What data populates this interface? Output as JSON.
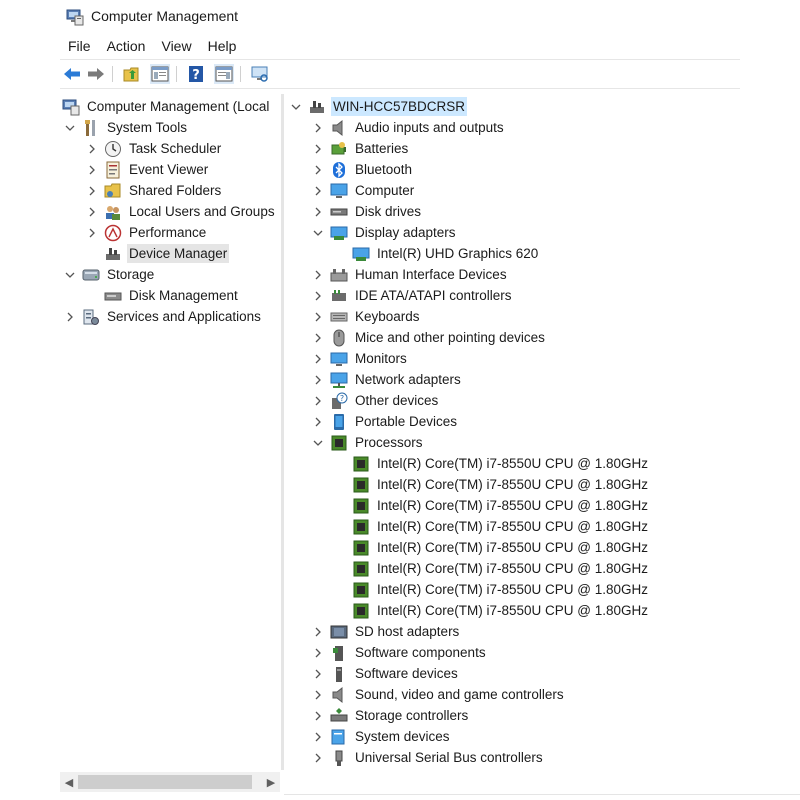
{
  "window": {
    "title": "Computer Management",
    "icon": "computer-management-icon"
  },
  "menu": {
    "file": "File",
    "action": "Action",
    "view": "View",
    "help": "Help"
  },
  "toolbar": {
    "buttons": [
      "back-arrow-icon",
      "forward-arrow-icon",
      "up-folder-icon",
      "show-hide-tree-icon",
      "help-icon",
      "properties-icon",
      "monitor-icon"
    ],
    "colors": {
      "back": "#2b7bd6",
      "forward": "#7a7a7a"
    }
  },
  "left_tree": {
    "root": "Computer Management (Local",
    "system_tools": "System Tools",
    "task_scheduler": "Task Scheduler",
    "event_viewer": "Event Viewer",
    "shared_folders": "Shared Folders",
    "local_users": "Local Users and Groups",
    "performance": "Performance",
    "device_manager": "Device Manager",
    "storage": "Storage",
    "disk_management": "Disk Management",
    "services": "Services and Applications"
  },
  "device_tree": {
    "computer_name": "WIN-HCC57BDCRSR",
    "categories": {
      "audio": "Audio inputs and outputs",
      "batteries": "Batteries",
      "bluetooth": "Bluetooth",
      "computer": "Computer",
      "disk_drives": "Disk drives",
      "display_adapters": "Display adapters",
      "display_child": "Intel(R) UHD Graphics 620",
      "hid": "Human Interface Devices",
      "ide": "IDE ATA/ATAPI controllers",
      "keyboards": "Keyboards",
      "mice": "Mice and other pointing devices",
      "monitors": "Monitors",
      "network": "Network adapters",
      "other": "Other devices",
      "portable": "Portable Devices",
      "processors": "Processors",
      "cpu": "Intel(R) Core(TM) i7-8550U CPU @ 1.80GHz",
      "sd_host": "SD host adapters",
      "software_components": "Software components",
      "software_devices": "Software devices",
      "sound": "Sound, video and game controllers",
      "storage_controllers": "Storage controllers",
      "system_devices": "System devices",
      "usb": "Universal Serial Bus controllers"
    }
  },
  "colors": {
    "selection": "#cce8ff",
    "selected_inactive": "#e5e5e5",
    "chevron": "#555555"
  }
}
